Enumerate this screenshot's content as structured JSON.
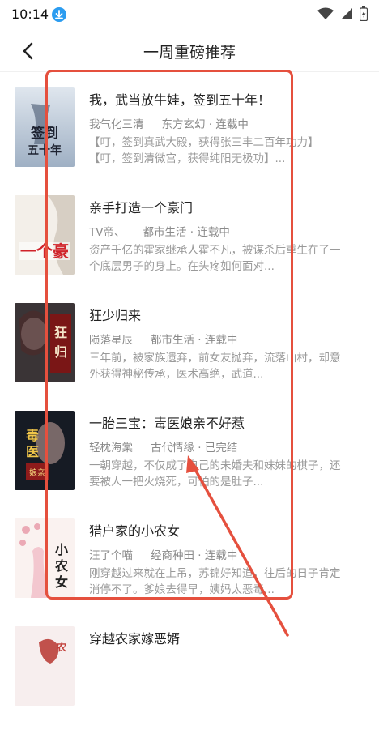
{
  "status_bar": {
    "time": "10:14"
  },
  "header": {
    "title": "一周重磅推荐"
  },
  "books": [
    {
      "title": "我，武当放牛娃，签到五十年！",
      "author": "我气化三清",
      "category": "东方玄幻 · 连载中",
      "description": "【叮，签到真武大殿，获得张三丰二百年功力】【叮，签到清微宫，获得纯阳无极功】...",
      "cover_text": "签到五十年"
    },
    {
      "title": "亲手打造一个豪门",
      "author": "TV帝、",
      "category": "都市生活 · 连载中",
      "description": "资产千亿的霍家继承人霍不凡，被谋杀后重生在了一个底层男子的身上。在头疼如何面对...",
      "cover_text": "一个豪门"
    },
    {
      "title": "狂少归来",
      "author": "陨落星辰",
      "category": "都市生活 · 连载中",
      "description": "三年前，被家族遗弃，前女友抛弃，流落山村，却意外获得神秘传承，医术高绝，武道...",
      "cover_text": "狂少归来"
    },
    {
      "title": "一胎三宝：毒医娘亲不好惹",
      "author": "轻枕海棠",
      "category": "古代情缘 · 已完结",
      "description": "一朝穿越，不仅成了自己的未婚夫和妹妹的棋子，还要被人一把火烧死，可怕的是肚子...",
      "cover_text": "毒医娘亲"
    },
    {
      "title": "猎户家的小农女",
      "author": "汪了个喵",
      "category": "经商种田 · 连载中",
      "description": "刚穿越过来就在上吊，苏锦好知道，往后的日子肯定消停不了。爹娘去得早，姨妈太恶毒...",
      "cover_text": "小农女"
    },
    {
      "title": "穿越农家嫁恶婿",
      "author": "",
      "category": "",
      "description": "",
      "cover_text": "农"
    }
  ],
  "colors": {
    "annotation": "#e5503e",
    "accent": "#2b9cf0"
  }
}
